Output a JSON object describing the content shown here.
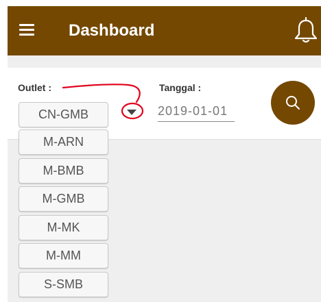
{
  "appbar": {
    "title": "Dashboard",
    "menu_icon": "hamburger-menu-icon",
    "notification_icon": "bell-icon"
  },
  "filter": {
    "outlet_label": "Outlet :",
    "outlet_selected": "CN-GMB",
    "outlet_options": [
      "M-ARN",
      "M-BMB",
      "M-GMB",
      "M-MK",
      "M-MM",
      "S-SMB"
    ],
    "date_label": "Tanggal :",
    "date_value": "2019-01-01",
    "search_icon": "search-icon"
  },
  "colors": {
    "primary": "#744800",
    "background": "#efefef",
    "annotation": "#e0001a"
  }
}
